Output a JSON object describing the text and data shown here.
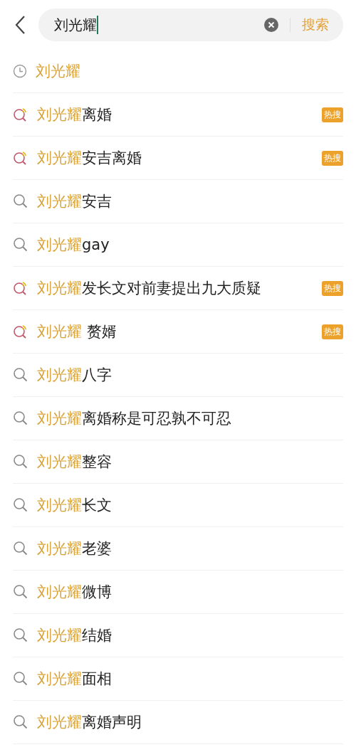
{
  "search": {
    "value": "刘光耀",
    "button": "搜索"
  },
  "suggestions": [
    {
      "kind": "history",
      "match": "刘光耀",
      "hot": false
    },
    {
      "kind": "trending",
      "match": "刘光耀",
      "rest": "离婚",
      "hot": true,
      "badge": "热搜"
    },
    {
      "kind": "trending",
      "match": "刘光耀",
      "rest": "安吉离婚",
      "hot": true,
      "badge": "热搜"
    },
    {
      "kind": "search",
      "match": "刘光耀",
      "rest": "安吉",
      "hot": false
    },
    {
      "kind": "search",
      "match": "刘光耀",
      "rest": "gay",
      "hot": false
    },
    {
      "kind": "trending",
      "match": "刘光耀",
      "rest": "发长文对前妻提出九大质疑",
      "hot": true,
      "badge": "热搜"
    },
    {
      "kind": "trending",
      "match": "刘光耀",
      "rest": " 赘婿",
      "hot": true,
      "badge": "热搜"
    },
    {
      "kind": "search",
      "match": "刘光耀",
      "rest": "八字",
      "hot": false
    },
    {
      "kind": "search",
      "match": "刘光耀",
      "rest": "离婚称是可忍孰不可忍",
      "hot": false
    },
    {
      "kind": "search",
      "match": "刘光耀",
      "rest": "整容",
      "hot": false
    },
    {
      "kind": "search",
      "match": "刘光耀",
      "rest": "长文",
      "hot": false
    },
    {
      "kind": "search",
      "match": "刘光耀",
      "rest": "老婆",
      "hot": false
    },
    {
      "kind": "search",
      "match": "刘光耀",
      "rest": "微博",
      "hot": false
    },
    {
      "kind": "search",
      "match": "刘光耀",
      "rest": "结婚",
      "hot": false
    },
    {
      "kind": "search",
      "match": "刘光耀",
      "rest": "面相",
      "hot": false
    },
    {
      "kind": "search",
      "match": "刘光耀",
      "rest": "离婚声明",
      "hot": false
    }
  ]
}
